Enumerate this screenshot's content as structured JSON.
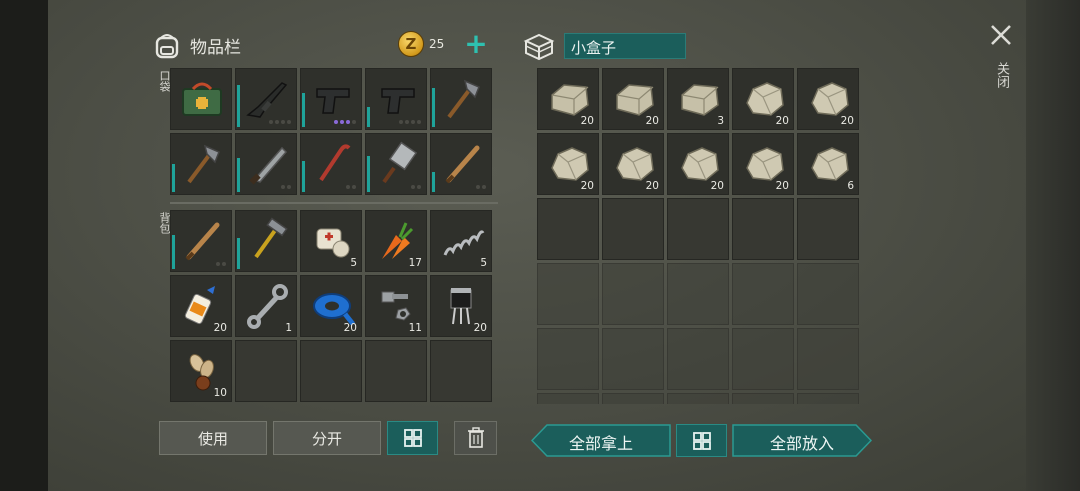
{
  "inventory": {
    "title": "物品栏",
    "coins": "25",
    "pocket_label": "口袋",
    "backpack_label": "背包",
    "pocket": [
      {
        "icon": "first-aid-kit-icon",
        "count": "",
        "durability": 0,
        "dots": 0
      },
      {
        "icon": "assault-rifle-icon",
        "count": "",
        "durability": 0.75,
        "dots": 4
      },
      {
        "icon": "pistol-icon",
        "count": "",
        "durability": 0.6,
        "dots": 4,
        "purple": 3
      },
      {
        "icon": "pistol-icon",
        "count": "",
        "durability": 0.35,
        "dots": 4
      },
      {
        "icon": "hatchet-icon",
        "count": "",
        "durability": 0.7,
        "dots": 0
      },
      {
        "icon": "hatchet-icon",
        "count": "",
        "durability": 0.5,
        "dots": 0
      },
      {
        "icon": "machete-icon",
        "count": "",
        "durability": 0.6,
        "dots": 2
      },
      {
        "icon": "crowbar-icon",
        "count": "",
        "durability": 0.55,
        "dots": 2
      },
      {
        "icon": "cleaver-icon",
        "count": "",
        "durability": 0.65,
        "dots": 2
      },
      {
        "icon": "baseball-bat-icon",
        "count": "",
        "durability": 0.35,
        "dots": 2
      }
    ],
    "backpack": [
      {
        "icon": "baseball-bat-icon",
        "count": "",
        "durability": 0.6,
        "dots": 2
      },
      {
        "icon": "hammer-icon",
        "count": "",
        "durability": 0.55,
        "dots": 0
      },
      {
        "icon": "bandage-icon",
        "count": "5"
      },
      {
        "icon": "carrot-icon",
        "count": "17"
      },
      {
        "icon": "spring-icon",
        "count": "5"
      },
      {
        "icon": "glue-icon",
        "count": "20"
      },
      {
        "icon": "wrench-icon",
        "count": "1"
      },
      {
        "icon": "duct-tape-icon",
        "count": "20"
      },
      {
        "icon": "nuts-bolts-icon",
        "count": "11"
      },
      {
        "icon": "transistor-icon",
        "count": "20"
      },
      {
        "icon": "seeds-icon",
        "count": "10"
      },
      {
        "icon": "",
        "count": ""
      },
      {
        "icon": "",
        "count": ""
      },
      {
        "icon": "",
        "count": ""
      },
      {
        "icon": "",
        "count": ""
      }
    ],
    "buttons": {
      "use": "使用",
      "split": "分开"
    }
  },
  "container": {
    "title": "小盒子",
    "items": [
      {
        "icon": "stone-brick-icon",
        "count": "20"
      },
      {
        "icon": "stone-brick-icon",
        "count": "20"
      },
      {
        "icon": "stone-brick-icon",
        "count": "3"
      },
      {
        "icon": "rock-icon",
        "count": "20"
      },
      {
        "icon": "rock-icon",
        "count": "20"
      },
      {
        "icon": "rock-icon",
        "count": "20"
      },
      {
        "icon": "rock-icon",
        "count": "20"
      },
      {
        "icon": "rock-icon",
        "count": "20"
      },
      {
        "icon": "rock-icon",
        "count": "20"
      },
      {
        "icon": "rock-icon",
        "count": "6"
      }
    ],
    "take_all": "全部拿上",
    "put_all": "全部放入"
  },
  "close_label": "关闭",
  "colors": {
    "accent": "#1b5e5b",
    "durability": "#1fa39a",
    "rarity_purple": "#8a6ad8"
  }
}
